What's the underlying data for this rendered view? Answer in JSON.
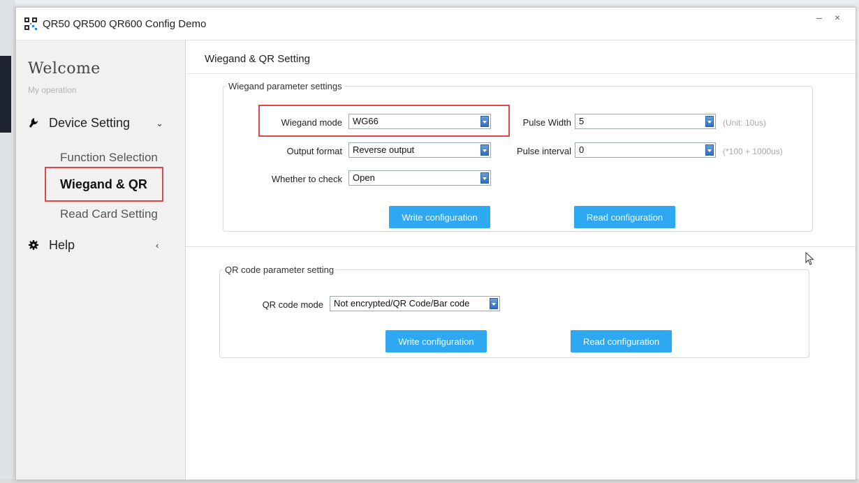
{
  "window": {
    "title": "QR50 QR500 QR600 Config Demo",
    "minimize": "–",
    "close": "×"
  },
  "sidebar": {
    "welcome": "Welcome",
    "subtitle": "My operation",
    "groups": [
      {
        "label": "Device Setting",
        "chevron": "⌄",
        "icon": "device-setting-icon"
      },
      {
        "label": "Help",
        "chevron": "‹",
        "icon": "help-gear-icon"
      }
    ],
    "items": [
      "Function Selection",
      "Wiegand & QR",
      "Read Card Setting"
    ],
    "selected": "Wiegand & QR"
  },
  "main": {
    "title": "Wiegand & QR Setting",
    "wiegand": {
      "legend": "Wiegand parameter settings",
      "mode_label": "Wiegand mode",
      "mode_value": "WG66",
      "output_label": "Output format",
      "output_value": "Reverse output",
      "check_label": "Whether to check",
      "check_value": "Open",
      "pulse_width_label": "Pulse Width",
      "pulse_width_value": "5",
      "pulse_width_unit": "(Unit:  10us)",
      "pulse_interval_label": "Pulse interval",
      "pulse_interval_value": "0",
      "pulse_interval_unit": "(*100 + 1000us)",
      "write_btn": "Write configuration",
      "read_btn": "Read configuration"
    },
    "qr": {
      "legend": "QR code parameter setting",
      "mode_label": "QR code mode",
      "mode_value": "Not encrypted/QR Code/Bar code",
      "write_btn": "Write configuration",
      "read_btn": "Read configuration"
    }
  },
  "colors": {
    "accent_button": "#2ea8f0",
    "highlight": "#e04646"
  }
}
